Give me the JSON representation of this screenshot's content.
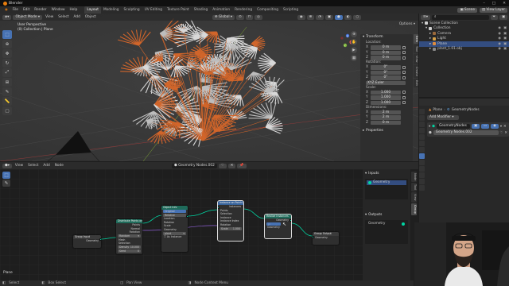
{
  "window": {
    "title": "Blender",
    "controls": [
      "–",
      "□",
      "✕"
    ]
  },
  "menu": {
    "items": [
      "File",
      "Edit",
      "Render",
      "Window",
      "Help"
    ],
    "workspaces": [
      "Layout",
      "Modeling",
      "Sculpting",
      "UV Editing",
      "Texture Paint",
      "Shading",
      "Animation",
      "Rendering",
      "Compositing",
      "Scripting"
    ],
    "active_workspace": "Layout",
    "scene": "Scene",
    "view_layer": "View Layer"
  },
  "viewport": {
    "mode": "Object Mode",
    "menus": [
      "View",
      "Select",
      "Add",
      "Object"
    ],
    "orientation": "Global",
    "options_label": "Options",
    "info_line1": "User Perspective",
    "info_line2": "(0) Collection | Plane",
    "axes": {
      "x": "X",
      "y": "Y",
      "z": "Z"
    }
  },
  "npanel": {
    "transform_title": "Transform",
    "location_label": "Location:",
    "location": [
      {
        "axis": "X",
        "value": "0 m"
      },
      {
        "axis": "Y",
        "value": "0 m"
      },
      {
        "axis": "Z",
        "value": "0 m"
      }
    ],
    "rotation_label": "Rotation:",
    "rotation": [
      {
        "axis": "X",
        "value": "0°"
      },
      {
        "axis": "Y",
        "value": "0°"
      },
      {
        "axis": "Z",
        "value": "0°"
      }
    ],
    "rotation_mode": "XYZ Euler",
    "scale_label": "Scale:",
    "scale": [
      {
        "axis": "X",
        "value": "1.000"
      },
      {
        "axis": "Y",
        "value": "1.000"
      },
      {
        "axis": "Z",
        "value": "1.000"
      }
    ],
    "dimensions_label": "Dimensions:",
    "dimensions": [
      {
        "axis": "X",
        "value": "2 m"
      },
      {
        "axis": "Y",
        "value": "2 m"
      },
      {
        "axis": "Z",
        "value": "0 m"
      }
    ],
    "properties_title": "Properties",
    "tabs": [
      "Item",
      "Tool",
      "View",
      "Create",
      "Edit"
    ]
  },
  "outliner": {
    "header": "Scene Collection",
    "items": [
      {
        "label": "Scene Collection",
        "color": "#cfcfcf",
        "indent": 0,
        "selected": false
      },
      {
        "label": "Collection",
        "color": "#cfcfcf",
        "indent": 1,
        "selected": false
      },
      {
        "label": "Camera",
        "color": "#9b6a3c",
        "indent": 2,
        "selected": false
      },
      {
        "label": "Light",
        "color": "#d5a047",
        "indent": 2,
        "selected": false
      },
      {
        "label": "Plane",
        "color": "#e08c3c",
        "indent": 2,
        "selected": true
      },
      {
        "label": "plant_1.01.obj",
        "color": "#8a8a8a",
        "indent": 2,
        "selected": false
      }
    ]
  },
  "properties": {
    "object_name": "Plane",
    "modifier_name_top": "GeometryNodes",
    "add_modifier": "Add Modifier",
    "modifier_name": "GeometryNodes",
    "node_group": "Geometry Nodes.002"
  },
  "node_editor": {
    "menus": [
      "View",
      "Select",
      "Add",
      "Node"
    ],
    "node_group": "Geometry Nodes.002",
    "sidebar": {
      "inputs_title": "Inputs",
      "inputs_item": "Geometry",
      "outputs_title": "Outputs",
      "outputs_item": "Geometry"
    },
    "tabs": [
      "Node",
      "Tool",
      "View",
      "Group"
    ],
    "corner_label": "Plane",
    "nodes": {
      "group_input": {
        "title": "Group Input",
        "out": "Geometry"
      },
      "distribute": {
        "title": "Distribute Points on Faces",
        "out1": "Points",
        "out2": "Normal",
        "out3": "Rotation",
        "mode": "Random",
        "in_mesh": "Mesh",
        "in_sel": "Selection",
        "density_label": "Density",
        "density": "10.000",
        "seed_label": "Seed",
        "seed": "0"
      },
      "object_info": {
        "title": "Object Info",
        "mode1": "Original",
        "mode2": "Relative",
        "obj": "plant",
        "loc": "Location",
        "rot": "Rotation",
        "scl": "Scale",
        "geo": "Geometry",
        "as_instance": "As Instance"
      },
      "instance": {
        "title": "Instance on Points",
        "out": "Instances",
        "rows": [
          "Points",
          "Selection",
          "Instance",
          "Instance Index",
          "Rotation",
          "Scale"
        ],
        "scale": "1.000"
      },
      "realize": {
        "title": "Realize Instances",
        "out": "Geometry",
        "in": "Geometry"
      },
      "group_output": {
        "title": "Group Output",
        "in": "Geometry"
      }
    }
  },
  "statusbar": {
    "items": [
      "Select",
      "Box Select",
      "Pan View",
      "Node Context Menu"
    ]
  },
  "colors": {
    "accent": "#4772b3",
    "selection": "#e87d0d",
    "geometry_socket": "#00d6a3",
    "plant_orange": "#d1652a"
  }
}
